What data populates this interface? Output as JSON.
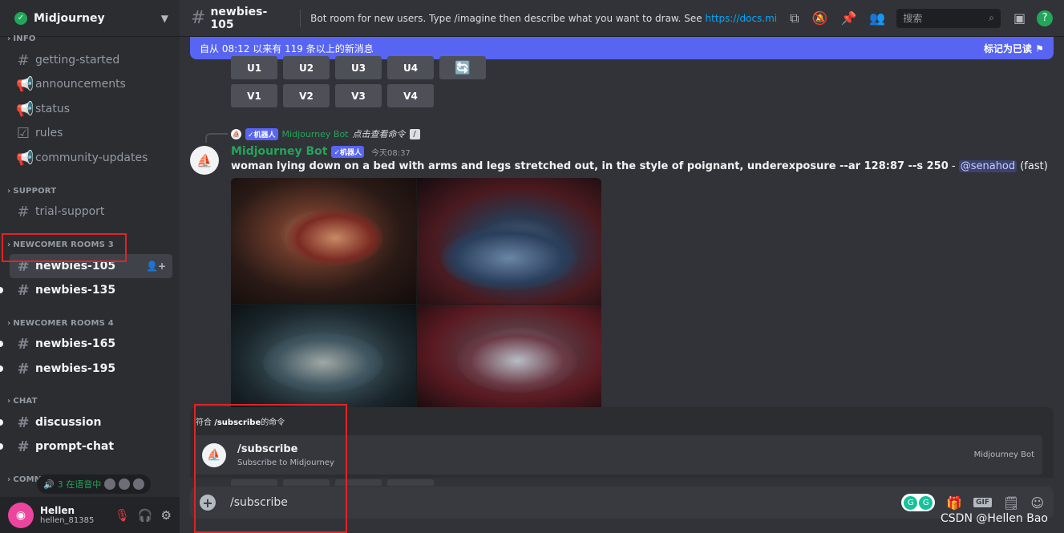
{
  "server": {
    "name": "Midjourney"
  },
  "sidebar": {
    "categories": {
      "info": "INFO",
      "support": "SUPPORT",
      "newcomer3": "NEWCOMER ROOMS 3",
      "newcomer4": "NEWCOMER ROOMS 4",
      "chat": "CHAT",
      "community": "COMM"
    },
    "channels": {
      "getting_started": "getting-started",
      "announcements": "announcements",
      "status": "status",
      "rules": "rules",
      "community_updates": "community-updates",
      "trial_support": "trial-support",
      "newbies_105": "newbies-105",
      "newbies_135": "newbies-135",
      "newbies_165": "newbies-165",
      "newbies_195": "newbies-195",
      "discussion": "discussion",
      "prompt_chat": "prompt-chat"
    },
    "voice_pill": "3 在语音中"
  },
  "user": {
    "name": "Hellen",
    "tag": "hellen_81385"
  },
  "topbar": {
    "channel": "newbies-105",
    "topic": "Bot room for new users. Type /imagine then describe what you want to draw. See ",
    "topic_link": "https://docs.midjourney...",
    "search_placeholder": "搜索"
  },
  "new_messages_bar": {
    "text": "自从 08:12 以来有 119 条以上的新消息",
    "action": "标记为已读"
  },
  "upscale_buttons": [
    "U1",
    "U2",
    "U3",
    "U4"
  ],
  "variation_buttons": [
    "V1",
    "V2",
    "V3",
    "V4"
  ],
  "reply": {
    "badge": "✓机器人",
    "name": "Midjourney Bot",
    "command": "点击查看命令"
  },
  "message": {
    "author": "Midjourney Bot",
    "badge": "✓机器人",
    "time": "今天08:37",
    "prompt": "woman lying down on a bed with arms and legs stretched out, in the style of poignant, underexposure --ar 128:87 --s 250",
    "separator": " - ",
    "mention": "@senahod",
    "mode": " (fast)"
  },
  "autocomplete": {
    "header_prefix": "符合 ",
    "header_cmd": "/subscribe",
    "header_suffix": "的命令",
    "command": "/subscribe",
    "description": "Subscribe to Midjourney",
    "source": "Midjourney Bot"
  },
  "composer": {
    "value": "/subscribe",
    "gif": "GIF"
  },
  "watermark": "CSDN @Hellen Bao",
  "colors": {
    "blurple": "#5865f2",
    "green": "#23a55a",
    "annotation_red": "#e02424"
  },
  "icons": [
    "verified-icon",
    "chevron-down-icon",
    "hash-icon",
    "megaphone-icon",
    "rules-icon",
    "add-member-icon",
    "threads-icon",
    "mute-notif-icon",
    "pin-icon",
    "members-icon",
    "search-icon",
    "inbox-icon",
    "help-icon",
    "reroll-icon",
    "plus-icon",
    "gift-icon",
    "gif-icon",
    "sticker-icon",
    "emoji-icon",
    "mic-muted-icon",
    "headphones-icon",
    "settings-icon"
  ]
}
